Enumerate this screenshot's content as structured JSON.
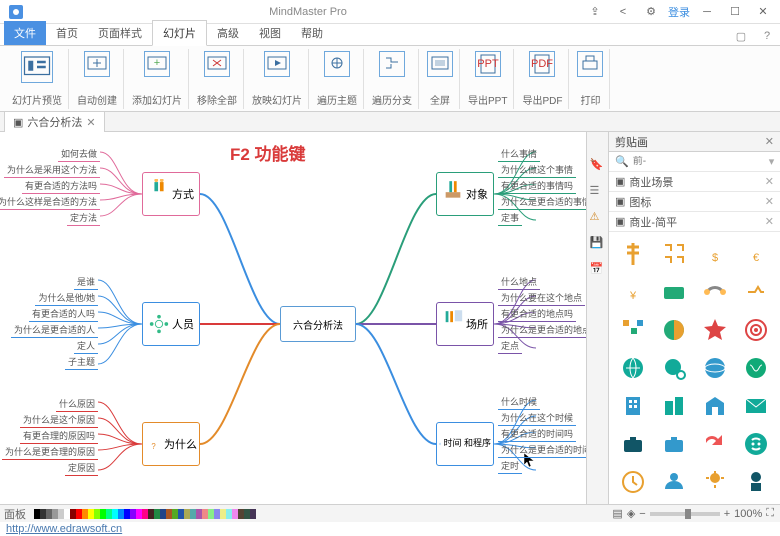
{
  "window": {
    "app": "MindMaster Pro",
    "login": "登录"
  },
  "tabs": {
    "file": "文件",
    "t1": "首页",
    "t2": "页面样式",
    "t3": "幻灯片",
    "t4": "高级",
    "t5": "视图",
    "t6": "帮助"
  },
  "ribbon": {
    "g1": "幻灯片预览",
    "g2": "自动创建",
    "g3": "添加幻灯片",
    "g4": "移除全部",
    "g5": "放映幻灯片",
    "g6": "遍历主题",
    "g7": "遍历分支",
    "g8": "全屏",
    "g9": "导出PPT",
    "g10": "导出PDF",
    "g11": "打印"
  },
  "doc": {
    "name": "六合分析法"
  },
  "side": {
    "title": "剪贴画",
    "prefix": "前-",
    "cat1": "商业场景",
    "cat2": "图标",
    "cat3": "商业-简平"
  },
  "annot": {
    "f2": "F2 功能键"
  },
  "mind": {
    "center": "六合分析法",
    "left": {
      "n1": {
        "label": "方式",
        "items": [
          "如何去做",
          "为什么是采用这个方法",
          "有更合适的方法吗",
          "为什么这样是合适的方法",
          "定方法"
        ]
      },
      "n2": {
        "label": "人员",
        "items": [
          "是谁",
          "为什么是他/她",
          "有更合适的人吗",
          "为什么是更合适的人",
          "定人",
          "子主题"
        ]
      },
      "n3": {
        "label": "为什么",
        "items": [
          "什么原因",
          "为什么是这个原因",
          "有更合理的原因吗",
          "为什么是更合理的原因",
          "定原因"
        ]
      }
    },
    "right": {
      "n1": {
        "label": "对象",
        "items": [
          "什么事情",
          "为什么做这个事情",
          "有更合适的事情吗",
          "为什么是更合适的事情",
          "定事"
        ]
      },
      "n2": {
        "label": "场所",
        "items": [
          "什么地点",
          "为什么要在这个地点",
          "有更合适的地点吗",
          "为什么是更合适的地点",
          "定点"
        ]
      },
      "n3": {
        "label": "时间\n和程序",
        "items": [
          "什么时候",
          "为什么在这个时候",
          "有更合适的时间吗",
          "为什么是更合适的时间",
          "定时"
        ]
      }
    }
  },
  "status": {
    "label": "面板",
    "zoom": "100%",
    "url": "http://www.edrawsoft.cn"
  }
}
